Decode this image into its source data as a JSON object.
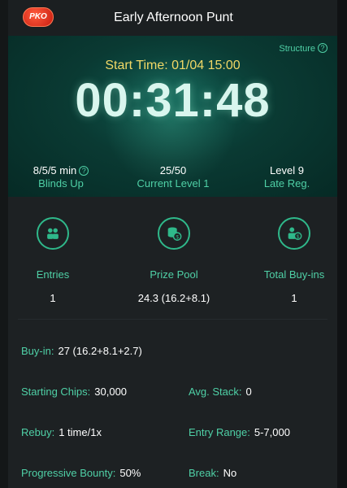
{
  "header": {
    "badge": "PKO",
    "title": "Early Afternoon Punt"
  },
  "hero": {
    "structure_label": "Structure",
    "start_time": "Start Time: 01/04 15:00",
    "clock": "00:31:48",
    "stats": [
      {
        "value": "8/5/5 min",
        "label": "Blinds Up",
        "has_help": true
      },
      {
        "value": "25/50",
        "label": "Current Level 1"
      },
      {
        "value": "Level 9",
        "label": "Late Reg."
      }
    ]
  },
  "summary": [
    {
      "icon": "players-icon",
      "label": "Entries",
      "value": "1"
    },
    {
      "icon": "coins-icon",
      "label": "Prize Pool",
      "value": "24.3 (16.2+8.1)"
    },
    {
      "icon": "buyin-icon",
      "label": "Total Buy-ins",
      "value": "1"
    }
  ],
  "details": {
    "buyin": {
      "key": "Buy-in:",
      "value": "27 (16.2+8.1+2.7)"
    },
    "starting_chips": {
      "key": "Starting Chips:",
      "value": "30,000"
    },
    "avg_stack": {
      "key": "Avg. Stack:",
      "value": "0"
    },
    "rebuy": {
      "key": "Rebuy:",
      "value": "1 time/1x"
    },
    "entry_range": {
      "key": "Entry Range:",
      "value": "5-7,000"
    },
    "progressive_bounty": {
      "key": "Progressive Bounty:",
      "value": "50%"
    },
    "break": {
      "key": "Break:",
      "value": "No"
    }
  },
  "colors": {
    "accent": "#4fd0a6",
    "start_time": "#f1d866",
    "badge": "#d9281a"
  }
}
